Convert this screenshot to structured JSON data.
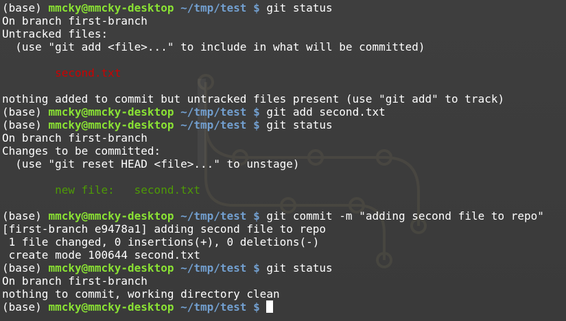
{
  "terminal": {
    "lines": [
      {
        "type": "prompt",
        "base": "(base) ",
        "user": "mmcky@mmcky-desktop",
        "path": " ~/tmp/test",
        "sign": " $",
        "cmd": " git status"
      },
      {
        "type": "text",
        "text": "On branch first-branch"
      },
      {
        "type": "text",
        "text": "Untracked files:"
      },
      {
        "type": "text",
        "text": "  (use \"git add <file>...\" to include in what will be committed)"
      },
      {
        "type": "blank"
      },
      {
        "type": "red",
        "text": "\tsecond.txt"
      },
      {
        "type": "blank"
      },
      {
        "type": "text",
        "text": "nothing added to commit but untracked files present (use \"git add\" to track)"
      },
      {
        "type": "prompt",
        "base": "(base) ",
        "user": "mmcky@mmcky-desktop",
        "path": " ~/tmp/test",
        "sign": " $",
        "cmd": " git add second.txt"
      },
      {
        "type": "prompt",
        "base": "(base) ",
        "user": "mmcky@mmcky-desktop",
        "path": " ~/tmp/test",
        "sign": " $",
        "cmd": " git status"
      },
      {
        "type": "text",
        "text": "On branch first-branch"
      },
      {
        "type": "text",
        "text": "Changes to be committed:"
      },
      {
        "type": "text",
        "text": "  (use \"git reset HEAD <file>...\" to unstage)"
      },
      {
        "type": "blank"
      },
      {
        "type": "green",
        "text": "\tnew file:   second.txt"
      },
      {
        "type": "blank"
      },
      {
        "type": "prompt",
        "base": "(base) ",
        "user": "mmcky@mmcky-desktop",
        "path": " ~/tmp/test",
        "sign": " $",
        "cmd": " git commit -m \"adding second file to repo\""
      },
      {
        "type": "text",
        "text": "[first-branch e9478a1] adding second file to repo"
      },
      {
        "type": "text",
        "text": " 1 file changed, 0 insertions(+), 0 deletions(-)"
      },
      {
        "type": "text",
        "text": " create mode 100644 second.txt"
      },
      {
        "type": "prompt",
        "base": "(base) ",
        "user": "mmcky@mmcky-desktop",
        "path": " ~/tmp/test",
        "sign": " $",
        "cmd": " git status"
      },
      {
        "type": "text",
        "text": "On branch first-branch"
      },
      {
        "type": "text",
        "text": "nothing to commit, working directory clean"
      },
      {
        "type": "prompt",
        "base": "(base) ",
        "user": "mmcky@mmcky-desktop",
        "path": " ~/tmp/test",
        "sign": " $",
        "cmd": " ",
        "cursor": true
      }
    ]
  },
  "colors": {
    "background": "#3c3c3c",
    "text": "#ffffff",
    "user": "#8ae234",
    "path": "#729fcf",
    "untracked": "#cc0000",
    "staged": "#4e9a06"
  }
}
